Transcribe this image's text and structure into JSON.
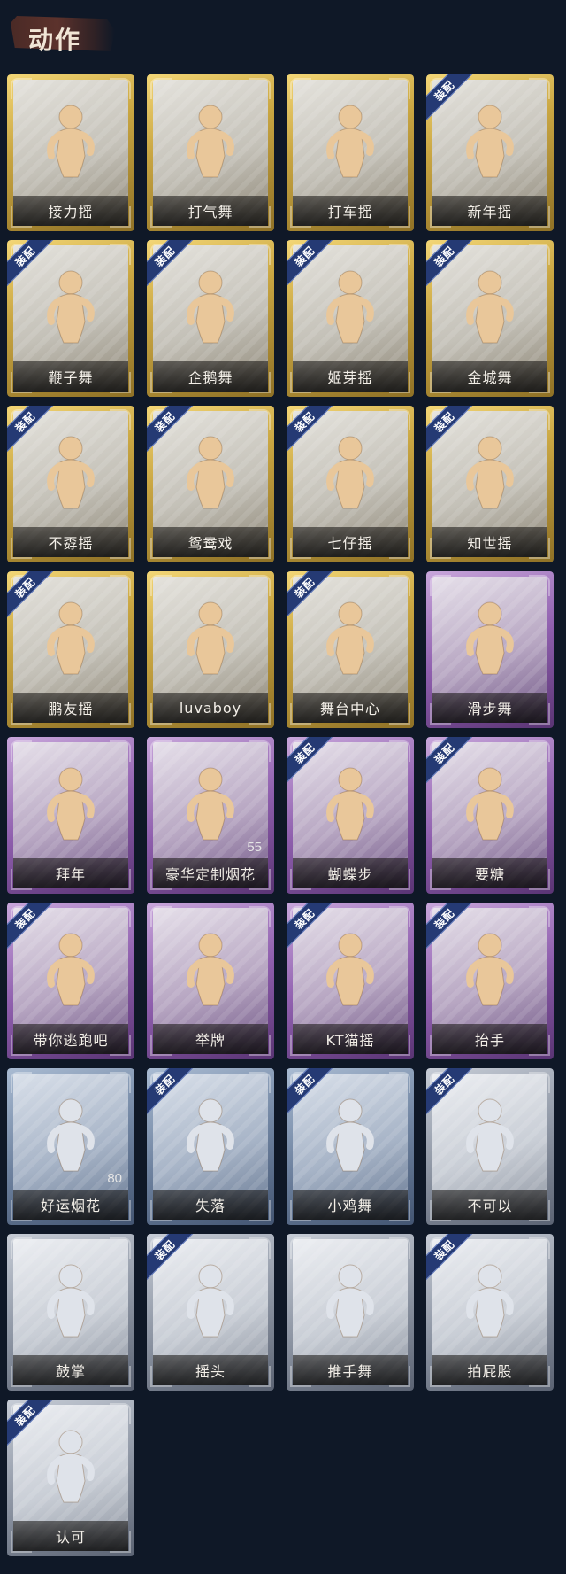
{
  "section_title": "动作",
  "badge_text": "装配",
  "colors": {
    "background": "#0f1827",
    "gold_frame": "#c9a642",
    "purple_frame": "#8f5fae",
    "silver_frame": "#8f97a5",
    "blue_frame": "#6f83a0",
    "equip_badge": "#253a74",
    "figure_gold": "#e9c79a",
    "figure_purple": "#e9c79a",
    "figure_silver": "#dfe3ea"
  },
  "cards": [
    {
      "label": "接力摇",
      "tier": "gold",
      "equipped": false
    },
    {
      "label": "打气舞",
      "tier": "gold",
      "equipped": false
    },
    {
      "label": "打车摇",
      "tier": "gold",
      "equipped": false
    },
    {
      "label": "新年摇",
      "tier": "gold",
      "equipped": true
    },
    {
      "label": "鞭子舞",
      "tier": "gold",
      "equipped": true
    },
    {
      "label": "企鹅舞",
      "tier": "gold",
      "equipped": true
    },
    {
      "label": "姬芽摇",
      "tier": "gold",
      "equipped": true
    },
    {
      "label": "金城舞",
      "tier": "gold",
      "equipped": true
    },
    {
      "label": "不孬摇",
      "tier": "gold",
      "equipped": true
    },
    {
      "label": "鸳鸯戏",
      "tier": "gold",
      "equipped": true
    },
    {
      "label": "七仔摇",
      "tier": "gold",
      "equipped": true
    },
    {
      "label": "知世摇",
      "tier": "gold",
      "equipped": true
    },
    {
      "label": "鹏友摇",
      "tier": "gold",
      "equipped": true
    },
    {
      "label": "luvaboy",
      "tier": "gold",
      "equipped": false
    },
    {
      "label": "舞台中心",
      "tier": "gold",
      "equipped": true
    },
    {
      "label": "滑步舞",
      "tier": "purple",
      "equipped": false
    },
    {
      "label": "拜年",
      "tier": "purple",
      "equipped": false
    },
    {
      "label": "豪华定制烟花",
      "tier": "purple",
      "equipped": false,
      "count": "55"
    },
    {
      "label": "蝴蝶步",
      "tier": "purple",
      "equipped": true
    },
    {
      "label": "要糖",
      "tier": "purple",
      "equipped": true
    },
    {
      "label": "带你逃跑吧",
      "tier": "purple",
      "equipped": true
    },
    {
      "label": "举牌",
      "tier": "purple",
      "equipped": false
    },
    {
      "label": "KT猫摇",
      "tier": "purple",
      "equipped": true
    },
    {
      "label": "抬手",
      "tier": "purple",
      "equipped": true
    },
    {
      "label": "好运烟花",
      "tier": "blue",
      "equipped": false,
      "count": "80"
    },
    {
      "label": "失落",
      "tier": "blue",
      "equipped": true
    },
    {
      "label": "小鸡舞",
      "tier": "blue",
      "equipped": true
    },
    {
      "label": "不可以",
      "tier": "silver",
      "equipped": true
    },
    {
      "label": "鼓掌",
      "tier": "silver",
      "equipped": false
    },
    {
      "label": "摇头",
      "tier": "silver",
      "equipped": true
    },
    {
      "label": "推手舞",
      "tier": "silver",
      "equipped": false
    },
    {
      "label": "拍屁股",
      "tier": "silver",
      "equipped": true
    },
    {
      "label": "认可",
      "tier": "silver",
      "equipped": true
    }
  ]
}
